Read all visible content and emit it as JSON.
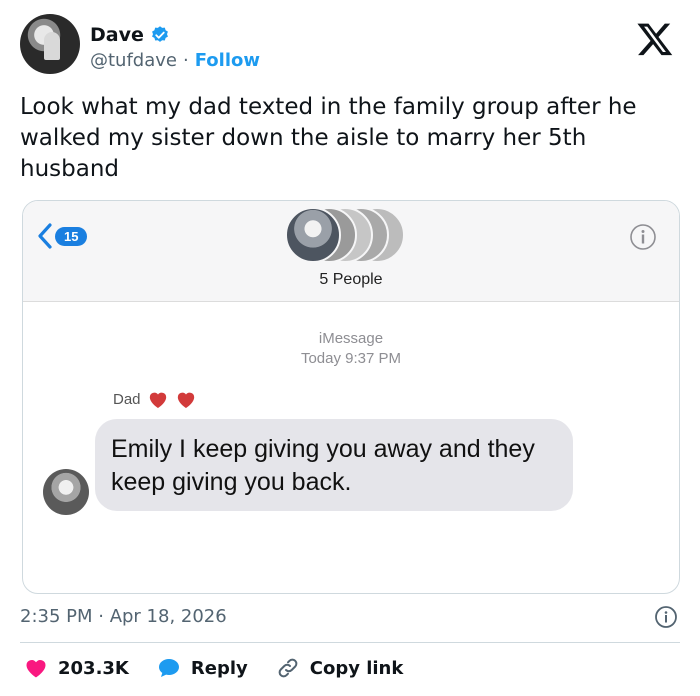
{
  "tweet": {
    "author_name": "Dave",
    "handle": "@tufdave",
    "separator": "·",
    "follow_label": "Follow",
    "text": "Look what my dad texted in the family group after he walked my sister down the aisle to marry her 5th husband",
    "time": "2:35 PM · Apr 18, 2026"
  },
  "screenshot": {
    "back_count": "15",
    "group_name": "5 People",
    "service": "iMessage",
    "timestamp": "Today 9:37 PM",
    "sender": "Dad",
    "message": "Emily I keep giving you away and they keep giving you back."
  },
  "actions": {
    "likes": "203.3K",
    "reply_label": "Reply",
    "copy_label": "Copy link"
  },
  "icons": {
    "verified": "verified-badge-icon",
    "logo": "x-logo-icon",
    "info": "info-icon",
    "heart": "heart-icon",
    "reply": "reply-bubble-icon",
    "link": "link-icon"
  },
  "colors": {
    "accent": "#1d9bf0",
    "like": "#f91880",
    "imessage_blue": "#1a7fe0",
    "bubble_gray": "#e5e5ea"
  }
}
